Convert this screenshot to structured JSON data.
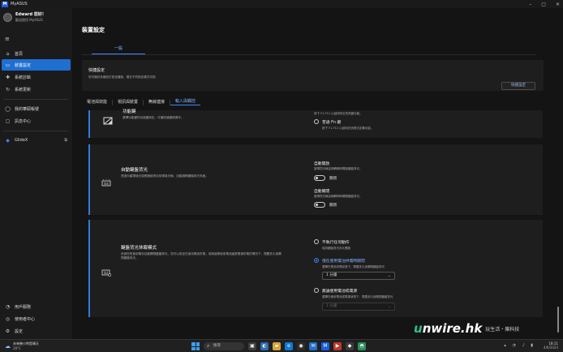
{
  "titlebar": {
    "app_name": "MyASUS",
    "logo_text": "M"
  },
  "sidebar": {
    "user_name": "Edward 您好！",
    "user_sub": "歡迎使用 MyASUS",
    "items": [
      {
        "label": "首頁",
        "icon": "⌂"
      },
      {
        "label": "裝置設定",
        "icon": "▭"
      },
      {
        "label": "系統診斷",
        "icon": "✚"
      },
      {
        "label": "系統更新",
        "icon": "↻"
      },
      {
        "label": "我的華碩帳號",
        "icon": "◯"
      },
      {
        "label": "訊息中心",
        "icon": "▢"
      },
      {
        "label": "GlideX",
        "icon": "◆"
      },
      {
        "label": "用戶服務",
        "icon": "◔"
      },
      {
        "label": "使用者中心",
        "icon": "◎"
      },
      {
        "label": "設定",
        "icon": "⚙"
      }
    ],
    "ext_icon": "⧉"
  },
  "main": {
    "page_title": "裝置設定",
    "top_tab": "一般",
    "quick": {
      "title": "快捷設定",
      "desc": "您可儲存多種自訂設定檔案，隨在不同設定模式切換",
      "button": "快捷設定"
    },
    "subtabs": [
      "電池與效能",
      "視訊與裝置",
      "無線連接",
      "輸入與觸控"
    ],
    "section1": {
      "title": "功能鍵",
      "desc": "選擇功能鍵的功能鍵設定，可讓快速鍵使操作。",
      "opt1_desc": "按下 F1-F12 以啟用特定的熱鍵功能。",
      "opt2_label": "普通 Fn 鍵",
      "opt2_desc": "按下 F1-F12 以啟用在該程式定義功能。"
    },
    "section2": {
      "title": "自動鍵盤背光",
      "desc": "透過內建環境光感應器偵測目前環境光線，自動調節鍵盤背光亮度。",
      "auto_on_label": "自動開啟",
      "auto_on_desc": "當環境光線由明轉暗時開啟鍵盤背光。",
      "auto_on_state": "關閉",
      "auto_off_label": "自動關閉",
      "auto_off_desc": "當環境光線由暗轉明時關閉鍵盤背光。",
      "auto_off_state": "關閉"
    },
    "section3": {
      "title": "鍵盤背光休眠模式",
      "desc": "依據您的使用情況自動關閉鍵盤背光，您可以設定在使用電池供電，或無論是使用電池還是電源供電的情況下，閒置多久後關閉鍵盤背光。",
      "opt1_label": "不執行任何動作",
      "opt1_desc": "保持鍵盤背光永久開啟",
      "opt2_label": "僅在使用電池供電時關閉",
      "opt2_desc": "選擇在電池供電狀態下，閒置多久後關閉鍵盤背光",
      "opt2_select": "1 分鐘",
      "opt3_label": "無論使用電池或電源",
      "opt3_desc": "選擇在使用電池或電源狀態下，閒置多久後關閉鍵盤背光",
      "opt3_select": "1 分鐘"
    }
  },
  "watermark": {
    "brand_a": "u",
    "brand_b": "nwire.hk",
    "tag": "玩生活・樂科技"
  },
  "taskbar": {
    "weather_temp": "28°C",
    "weather_text": "未來幾小時是晴天",
    "search_placeholder": "搜尋",
    "time": "18:11",
    "date": "4/6/2024",
    "apps": [
      {
        "icon": "▣",
        "color": "#3c3c3c"
      },
      {
        "icon": "◐",
        "color": "#2b6cb0"
      },
      {
        "icon": "▰",
        "color": "#d9a33a"
      },
      {
        "icon": "e",
        "color": "#0f7bd8"
      },
      {
        "icon": "◉",
        "color": "#2c2c2c"
      },
      {
        "icon": "✉",
        "color": "#2370c8"
      },
      {
        "icon": "M",
        "color": "#1a5ee0"
      },
      {
        "icon": "▶",
        "color": "#c0392b"
      },
      {
        "icon": "◆",
        "color": "#3a3a3a"
      },
      {
        "icon": "◓",
        "color": "#2a8f5a"
      }
    ]
  }
}
